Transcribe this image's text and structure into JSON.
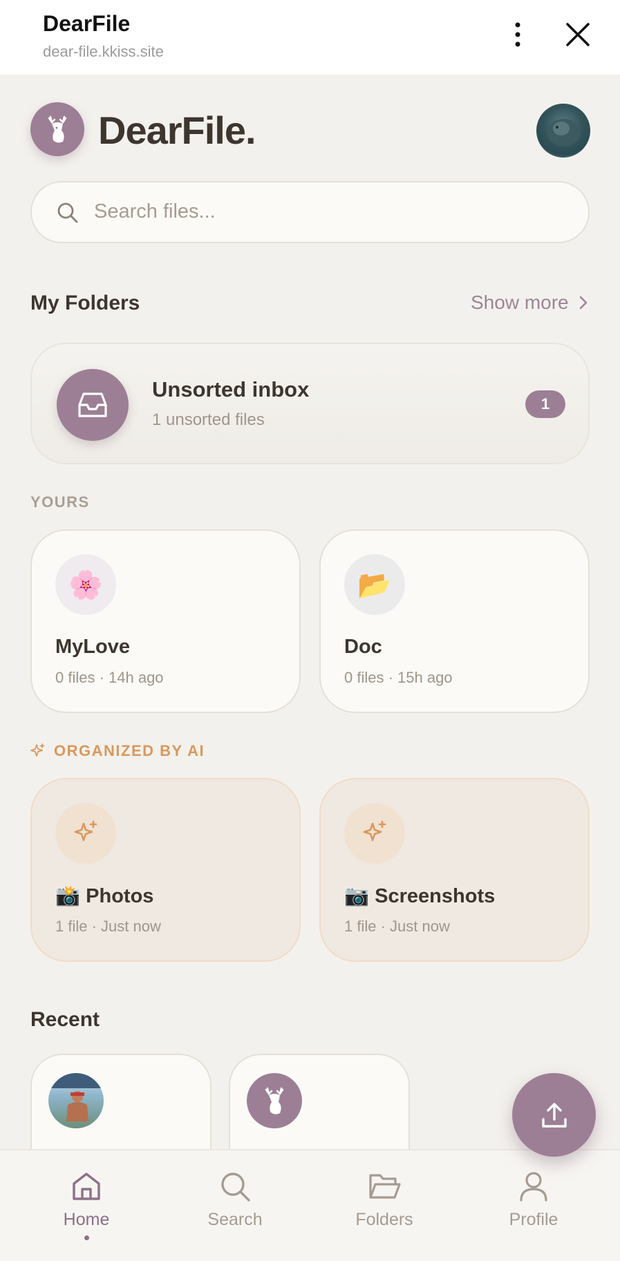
{
  "browser": {
    "title": "DearFile",
    "url": "dear-file.kkiss.site"
  },
  "header": {
    "brand": "DearFile."
  },
  "search": {
    "placeholder": "Search files..."
  },
  "my_folders": {
    "title": "My Folders",
    "show_more": "Show more"
  },
  "inbox": {
    "title": "Unsorted inbox",
    "subtitle": "1 unsorted files",
    "count": "1"
  },
  "yours": {
    "label": "YOURS",
    "folders": [
      {
        "icon": "🌸",
        "name": "MyLove",
        "meta": "0 files · 14h ago"
      },
      {
        "icon": "📂",
        "name": "Doc",
        "meta": "0 files · 15h ago"
      }
    ]
  },
  "ai": {
    "label": "ORGANIZED BY AI",
    "folders": [
      {
        "name": "📸 Photos",
        "meta": "1 file · Just now"
      },
      {
        "name": "📷 Screenshots",
        "meta": "1 file · Just now"
      }
    ]
  },
  "recent": {
    "title": "Recent"
  },
  "nav": {
    "items": [
      {
        "label": "Home",
        "active": true
      },
      {
        "label": "Search",
        "active": false
      },
      {
        "label": "Folders",
        "active": false
      },
      {
        "label": "Profile",
        "active": false
      }
    ]
  },
  "colors": {
    "accent": "#9c7f95",
    "ai_accent": "#d9985c",
    "background": "#f3f1ed"
  }
}
